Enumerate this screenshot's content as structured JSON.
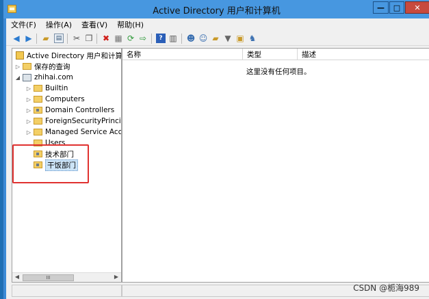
{
  "window": {
    "title": "Active Directory 用户和计算机",
    "minimize": "—",
    "maximize": "□",
    "close": "✕"
  },
  "menu": [
    "文件(F)",
    "操作(A)",
    "查看(V)",
    "帮助(H)"
  ],
  "toolbar_icons": [
    "back-arrow-icon",
    "forward-arrow-icon",
    "up-folder-icon",
    "show-tree-icon",
    "cut-icon",
    "copy-icon",
    "delete-icon",
    "properties-icon",
    "refresh-icon",
    "export-icon",
    "help-icon",
    "console-icon",
    "add-user-icon",
    "add-group-icon",
    "add-ou-icon",
    "filter-icon",
    "find-icon",
    "query-icon"
  ],
  "tree": {
    "root": "Active Directory 用户和计算机",
    "saved_queries": "保存的查询",
    "domain": "zhihai.com",
    "children": [
      "Builtin",
      "Computers",
      "Domain Controllers",
      "ForeignSecurityPrincipa",
      "Managed Service Acco",
      "Users",
      "技术部门",
      "干饭部门"
    ]
  },
  "list": {
    "columns": [
      "名称",
      "类型",
      "描述"
    ],
    "empty_text": "这里没有任何项目。"
  },
  "scroll_thumb": "III",
  "watermark": "CSDN @栀海989",
  "colors": {
    "title_bar": "#4797e0",
    "close_button": "#c74a3e",
    "highlight": "#e0312f"
  }
}
